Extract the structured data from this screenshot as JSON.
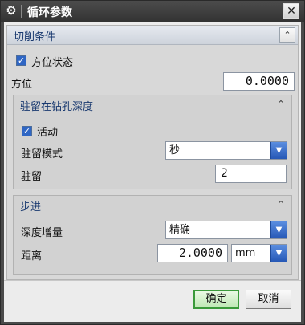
{
  "window": {
    "title": "循环参数",
    "settings_icon": "gear-icon",
    "close_symbol": "✕"
  },
  "sections": {
    "cutting_conditions": {
      "title": "切削条件",
      "collapse_symbol": "⌃",
      "orientation_state_label": "方位状态",
      "orientation_state_checked": true,
      "orientation_label": "方位",
      "orientation_value": "0.0000"
    },
    "dwell": {
      "title": "驻留在钻孔深度",
      "collapse_symbol": "⌃",
      "active_label": "活动",
      "active_checked": true,
      "mode_label": "驻留模式",
      "mode_value": "秒",
      "dwell_label": "驻留",
      "dwell_value": "2"
    },
    "step": {
      "title": "步进",
      "collapse_symbol": "⌃",
      "depth_increment_label": "深度增量",
      "depth_increment_value": "精确",
      "distance_label": "距离",
      "distance_value": "2.0000",
      "distance_unit": "mm"
    }
  },
  "footer": {
    "ok_label": "确定",
    "cancel_label": "取消"
  },
  "colors": {
    "accent_blue": "#2f66c4",
    "section_title": "#1a3a70",
    "ok_border": "#3a9a3a"
  }
}
